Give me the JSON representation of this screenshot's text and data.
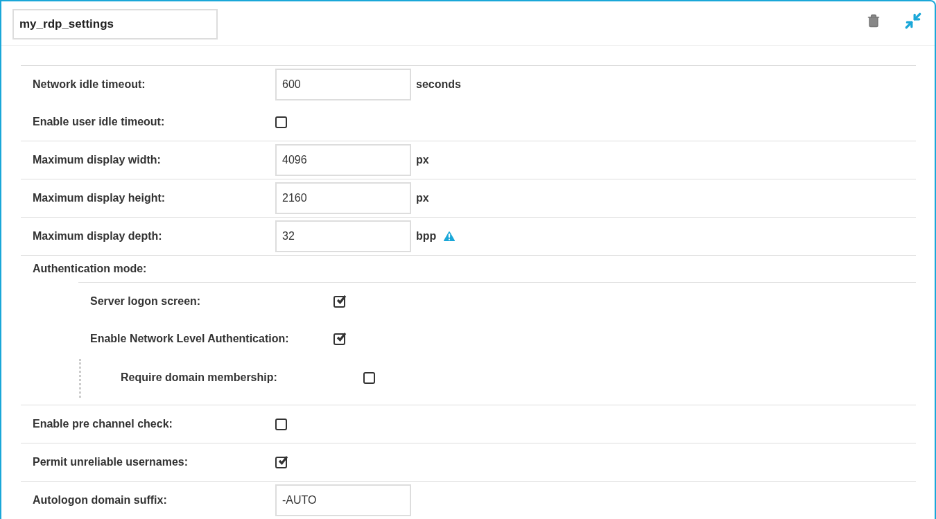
{
  "name_field": {
    "value": "my_rdp_settings"
  },
  "groups": [
    [
      {
        "kind": "input",
        "label": "Network idle timeout:",
        "value": "600",
        "unit": "seconds",
        "warning": false
      },
      {
        "kind": "checkbox",
        "label": "Enable user idle timeout:",
        "checked": false
      }
    ],
    [
      {
        "kind": "input",
        "label": "Maximum display width:",
        "value": "4096",
        "unit": "px",
        "warning": false
      }
    ],
    [
      {
        "kind": "input",
        "label": "Maximum display height:",
        "value": "2160",
        "unit": "px",
        "warning": false
      }
    ],
    [
      {
        "kind": "input",
        "label": "Maximum display depth:",
        "value": "32",
        "unit": "bpp",
        "warning": true
      }
    ],
    [
      {
        "kind": "heading",
        "label": "Authentication mode:",
        "children": [
          {
            "kind": "checkbox",
            "label": "Server logon screen:",
            "checked": true
          },
          {
            "kind": "checkbox",
            "label": "Enable Network Level Authentication:",
            "checked": true,
            "children": [
              {
                "kind": "checkbox",
                "label": "Require domain membership:",
                "checked": false
              }
            ]
          }
        ]
      }
    ],
    [
      {
        "kind": "checkbox",
        "label": "Enable pre channel check:",
        "checked": false
      }
    ],
    [
      {
        "kind": "checkbox",
        "label": "Permit unreliable usernames:",
        "checked": true
      }
    ],
    [
      {
        "kind": "input",
        "label": "Autologon domain suffix:",
        "value": "-AUTO",
        "warning": false
      }
    ]
  ]
}
